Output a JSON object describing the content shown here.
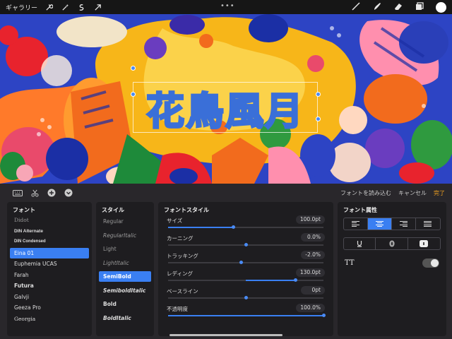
{
  "topbar": {
    "gallery_label": "ギャラリー",
    "more": "•••"
  },
  "canvas": {
    "title_text": "花鳥風月"
  },
  "panel": {
    "import_font": "フォントを読み込む",
    "cancel": "キャンセル",
    "done": "完了"
  },
  "fonts": {
    "header": "フォント",
    "items": [
      "Didot",
      "DIN Alternate",
      "DIN Condensed",
      "Eina 01",
      "Euphemia UCAS",
      "Farah",
      "Futura",
      "Galvji",
      "Geeza Pro",
      "Georgia"
    ],
    "selected": "Eina 01"
  },
  "styles": {
    "header": "スタイル",
    "items": [
      "Regular",
      "RegularItalic",
      "Light",
      "LightItalic",
      "SemiBold",
      "SemiboldItalic",
      "Bold",
      "BoldItalic"
    ],
    "selected": "SemiBold"
  },
  "font_style": {
    "header": "フォントスタイル",
    "sliders": [
      {
        "label": "サイズ",
        "value": "100.0pt",
        "position": 0.42
      },
      {
        "label": "カーニング",
        "value": "0.0%",
        "position": 0.5
      },
      {
        "label": "トラッキング",
        "value": "-2.0%",
        "position": 0.47
      },
      {
        "label": "レディング",
        "value": "130.0pt",
        "position": 0.82
      },
      {
        "label": "ベースライン",
        "value": "0pt",
        "position": 0.5
      },
      {
        "label": "不透明度",
        "value": "100.0%",
        "position": 1.0
      }
    ]
  },
  "font_attributes": {
    "header": "フォント属性",
    "alignment_selected": "center",
    "tt_label": "TT",
    "all_caps_enabled": false
  },
  "colors": {
    "accent": "#3a7ff2",
    "done": "#f0a020"
  }
}
